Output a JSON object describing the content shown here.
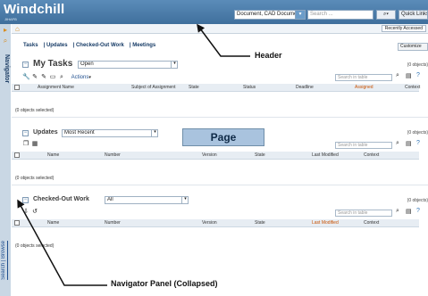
{
  "header": {
    "logo": "Windchill",
    "logo_sub": "JIHAFB",
    "context_select": "Document, CAD Document",
    "search_placeholder": "Search ...",
    "quick_links": "Quick Links"
  },
  "navigator": {
    "title": "Navigator",
    "bottom_links": "Search | Browse"
  },
  "crumb": {
    "recently_accessed": "Recently Accessed"
  },
  "main": {
    "tabs": [
      "Tasks",
      "Updates",
      "Checked-Out Work",
      "Meetings"
    ],
    "customize": "Customize"
  },
  "my_tasks": {
    "title": "My Tasks",
    "filter": "Open",
    "object_count": "(0 objects)",
    "actions_label": "Actions",
    "search_placeholder": "Search in table",
    "columns": [
      "Assignment Name",
      "Subject of Assignment",
      "State",
      "Status",
      "Deadline",
      "Assigned",
      "Context"
    ],
    "selected": "(0 objects selected)"
  },
  "updates": {
    "title": "Updates",
    "filter": "Most Recent",
    "object_count": "(0 objects)",
    "search_placeholder": "Search in table",
    "columns": [
      "Name",
      "Number",
      "Version",
      "State",
      "Last Modified",
      "Context"
    ],
    "selected": "(0 objects selected)"
  },
  "checked_out": {
    "title": "Checked-Out Work",
    "filter": "All",
    "object_count": "(0 objects)",
    "search_placeholder": "Search in table",
    "columns": [
      "Name",
      "Number",
      "Version",
      "State",
      "Last Modified",
      "Context"
    ],
    "selected": "(0 objects selected)"
  },
  "annotations": {
    "header": "Header",
    "page": "Page",
    "navigator": "Navigator Panel (Collapsed)"
  },
  "colors": {
    "header_bg": "#4a7eac",
    "accent": "#3f6f9c",
    "sort_highlight": "#c85000"
  }
}
